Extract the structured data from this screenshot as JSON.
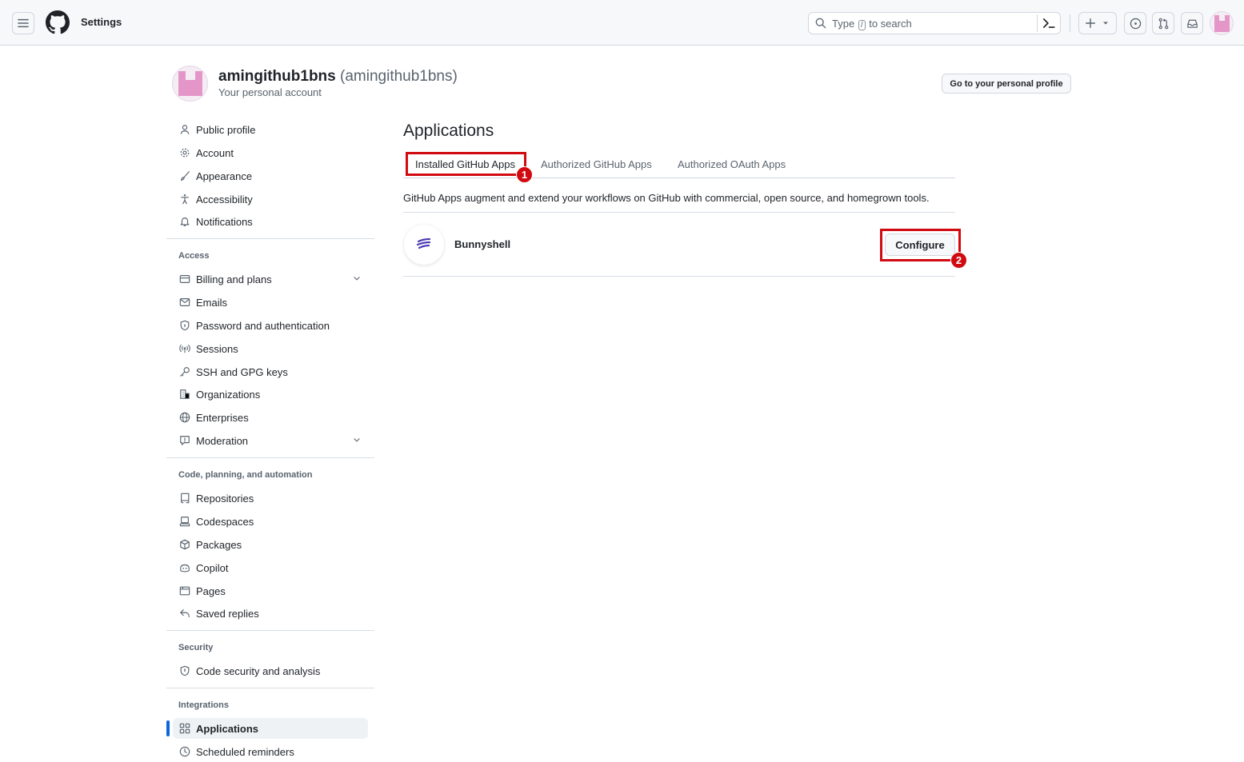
{
  "header": {
    "context_title": "Settings",
    "search": {
      "prefix": "Type",
      "key": "/",
      "suffix": "to search"
    }
  },
  "account": {
    "display_name": "amingithub1bns",
    "handle": "(amingithub1bns)",
    "subtitle": "Your personal account",
    "profile_button": "Go to your personal profile"
  },
  "sidebar": {
    "items_top": [
      {
        "label": "Public profile",
        "icon": "person-icon"
      },
      {
        "label": "Account",
        "icon": "gear-icon"
      },
      {
        "label": "Appearance",
        "icon": "paintbrush-icon"
      },
      {
        "label": "Accessibility",
        "icon": "accessibility-icon"
      },
      {
        "label": "Notifications",
        "icon": "bell-icon"
      }
    ],
    "access_heading": "Access",
    "access_items": [
      {
        "label": "Billing and plans",
        "icon": "credit-card-icon"
      },
      {
        "label": "Emails",
        "icon": "mail-icon"
      },
      {
        "label": "Password and authentication",
        "icon": "shield-lock-icon"
      },
      {
        "label": "Sessions",
        "icon": "broadcast-icon"
      },
      {
        "label": "SSH and GPG keys",
        "icon": "key-icon"
      },
      {
        "label": "Organizations",
        "icon": "organization-icon"
      },
      {
        "label": "Enterprises",
        "icon": "globe-icon"
      },
      {
        "label": "Moderation",
        "icon": "report-icon"
      }
    ],
    "code_heading": "Code, planning, and automation",
    "code_items": [
      {
        "label": "Repositories",
        "icon": "repo-icon"
      },
      {
        "label": "Codespaces",
        "icon": "codespaces-icon"
      },
      {
        "label": "Packages",
        "icon": "package-icon"
      },
      {
        "label": "Copilot",
        "icon": "copilot-icon"
      },
      {
        "label": "Pages",
        "icon": "browser-icon"
      },
      {
        "label": "Saved replies",
        "icon": "reply-icon"
      }
    ],
    "security_heading": "Security",
    "security_items": [
      {
        "label": "Code security and analysis",
        "icon": "shield-icon"
      }
    ],
    "integrations_heading": "Integrations",
    "integrations_items": [
      {
        "label": "Applications",
        "icon": "apps-icon",
        "active": true
      },
      {
        "label": "Scheduled reminders",
        "icon": "clock-icon"
      }
    ]
  },
  "main": {
    "title": "Applications",
    "tabs": [
      {
        "label": "Installed GitHub Apps",
        "selected": true
      },
      {
        "label": "Authorized GitHub Apps"
      },
      {
        "label": "Authorized OAuth Apps"
      }
    ],
    "description": "GitHub Apps augment and extend your workflows on GitHub with commercial, open source, and homegrown tools.",
    "apps": [
      {
        "name": "Bunnyshell",
        "action": "Configure"
      }
    ]
  },
  "annotations": [
    {
      "number": "1"
    },
    {
      "number": "2"
    }
  ],
  "colors": {
    "accent": "#0969da",
    "highlight": "#d10a11",
    "identicon": "#e496c8",
    "bunnyshell": "#4b3ab5"
  }
}
